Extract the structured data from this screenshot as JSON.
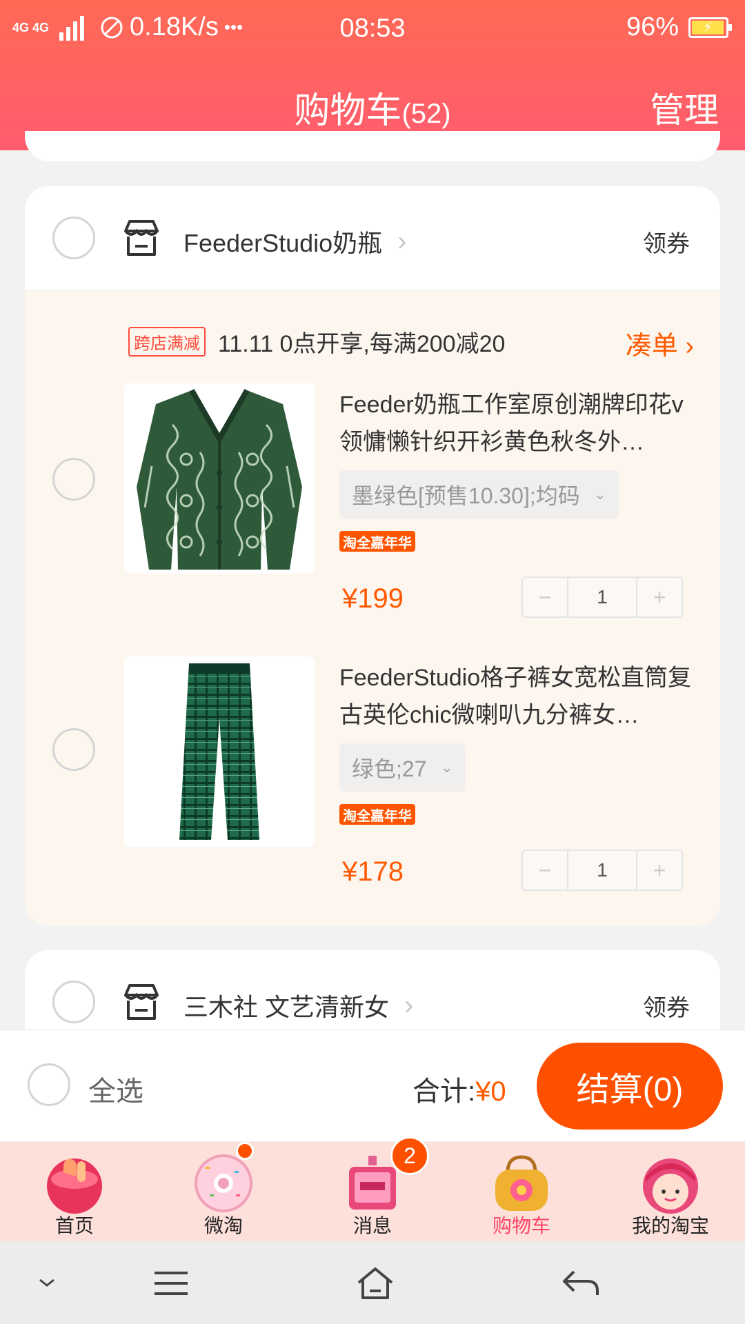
{
  "status_bar": {
    "network": "4G 4G",
    "speed": "0.18K/s",
    "more": "•••",
    "time": "08:53",
    "battery": "96%"
  },
  "header": {
    "title": "购物车",
    "count": "(52)",
    "manage": "管理"
  },
  "shops": [
    {
      "name": "FeederStudio奶瓶",
      "coupon": "领券",
      "promo": {
        "tag": "跨店满减",
        "text": "11.11 0点开享,每满200减20",
        "link": "凑单"
      },
      "items": [
        {
          "title": "Feeder奶瓶工作室原创潮牌印花v领慵懒针织开衫黄色秋冬外…",
          "sku": "墨绿色[预售10.30];均码",
          "badge": "淘全嘉年华",
          "price": "¥199",
          "qty": "1"
        },
        {
          "title": "FeederStudio格子裤女宽松直筒复古英伦chic微喇叭九分裤女…",
          "sku": "绿色;27",
          "badge": "淘全嘉年华",
          "price": "¥178",
          "qty": "1"
        }
      ]
    },
    {
      "name": "三木社 文艺清新女",
      "coupon": "领券"
    }
  ],
  "checkout": {
    "select_all": "全选",
    "total_label": "合计:",
    "total_amount": "¥0",
    "button": "结算(0)"
  },
  "tabs": [
    {
      "label": "首页",
      "icon": "home-icon"
    },
    {
      "label": "微淘",
      "icon": "weitao-icon"
    },
    {
      "label": "消息",
      "icon": "message-icon",
      "badge": "2"
    },
    {
      "label": "购物车",
      "icon": "cart-icon",
      "active": true
    },
    {
      "label": "我的淘宝",
      "icon": "profile-icon"
    }
  ],
  "colors": {
    "accent": "#ff5000",
    "header_start": "#ff6a55",
    "header_end": "#ff5c6e",
    "price": "#ff5a00",
    "active_tab": "#ff4466"
  }
}
